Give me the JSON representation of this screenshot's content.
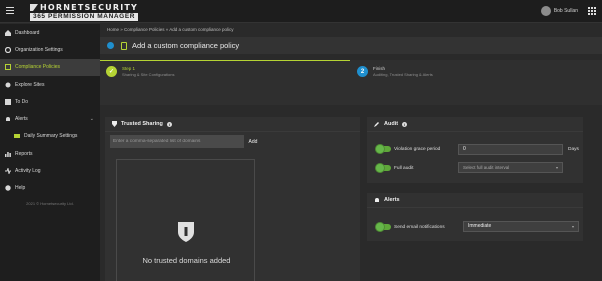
{
  "app": {
    "brand_line1": "HORNETSECURITY",
    "brand_line2": "365 PERMISSION MANAGER",
    "user_name": "Bob Sullan"
  },
  "sidebar": {
    "items": [
      {
        "label": "Dashboard",
        "icon": "home-icon",
        "active": false
      },
      {
        "label": "Organization Settings",
        "icon": "gear-icon",
        "active": false
      },
      {
        "label": "Compliance Policies",
        "icon": "checklist-icon",
        "active": true
      },
      {
        "label": "Explore Sites",
        "icon": "explore-icon",
        "active": false
      },
      {
        "label": "To Do",
        "icon": "todo-icon",
        "active": false
      },
      {
        "label": "Alerts",
        "icon": "bell-icon",
        "active": false
      },
      {
        "label": "Daily Summary Settings",
        "icon": "mail-icon",
        "active": false
      },
      {
        "label": "Reports",
        "icon": "chart-icon",
        "active": false
      },
      {
        "label": "Activity Log",
        "icon": "activity-icon",
        "active": false
      },
      {
        "label": "Help",
        "icon": "help-icon",
        "active": false
      }
    ],
    "copyright": "2021 © Hornetsecurity Ltd."
  },
  "breadcrumb": "Home » Compliance Policies » Add a custom compliance policy",
  "page_title": "Add a custom compliance policy",
  "steps": [
    {
      "number": "✓",
      "title": "Step 1",
      "subtitle": "Sharing & Site Configurations"
    },
    {
      "number": "2",
      "title": "Finish",
      "subtitle": "Auditing, Trusted Sharing & Alerts"
    }
  ],
  "trusted_sharing": {
    "title": "Trusted Sharing",
    "input_placeholder": "Enter a comma-separated list of domains",
    "add_label": "Add",
    "empty_text": "No trusted domains added"
  },
  "audit": {
    "title": "Audit",
    "violation_label": "Violation grace period",
    "violation_value": "0",
    "days_label": "Days",
    "full_audit_label": "Full audit",
    "full_audit_select": "Select full audit interval"
  },
  "alerts": {
    "title": "Alerts",
    "send_email_label": "Send email notifications",
    "frequency_value": "Immediate"
  },
  "colors": {
    "accent_green": "#b5d334",
    "step_blue": "#1f8fce",
    "toggle_green": "#5fa83a"
  }
}
